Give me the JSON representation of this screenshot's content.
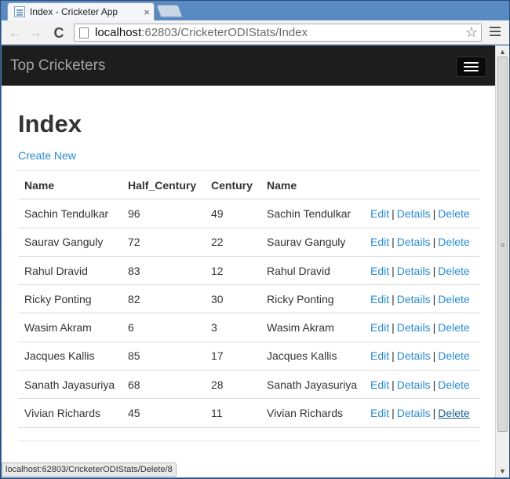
{
  "browser": {
    "tab_title": "Index - Cricketer App",
    "tab_close": "×",
    "url_host": "localhost",
    "url_path": ":62803/CricketerODIStats/Index",
    "status_url": "localhost:62803/CricketerODIStats/Delete/8"
  },
  "icons": {
    "back": "←",
    "forward": "→",
    "reload": "C",
    "star": "☆",
    "scroll_up": "▲",
    "scroll_down": "▼",
    "scroll_grip": "≡"
  },
  "navbar": {
    "brand": "Top Cricketers"
  },
  "page": {
    "title": "Index",
    "create_new": "Create New"
  },
  "table": {
    "headers": [
      "Name",
      "Half_Century",
      "Century",
      "Name",
      ""
    ],
    "rows": [
      {
        "name": "Sachin Tendulkar",
        "half_century": "96",
        "century": "49",
        "name2": "Sachin Tendulkar"
      },
      {
        "name": "Saurav Ganguly",
        "half_century": "72",
        "century": "22",
        "name2": "Saurav Ganguly"
      },
      {
        "name": "Rahul Dravid",
        "half_century": "83",
        "century": "12",
        "name2": "Rahul Dravid"
      },
      {
        "name": "Ricky Ponting",
        "half_century": "82",
        "century": "30",
        "name2": "Ricky Ponting"
      },
      {
        "name": "Wasim Akram",
        "half_century": "6",
        "century": "3",
        "name2": "Wasim Akram"
      },
      {
        "name": "Jacques Kallis",
        "half_century": "85",
        "century": "17",
        "name2": "Jacques Kallis"
      },
      {
        "name": "Sanath Jayasuriya",
        "half_century": "68",
        "century": "28",
        "name2": "Sanath Jayasuriya"
      },
      {
        "name": "Vivian Richards",
        "half_century": "45",
        "century": "11",
        "name2": "Vivian Richards"
      }
    ],
    "actions": {
      "edit": "Edit",
      "details": "Details",
      "delete": "Delete",
      "separator": "|"
    }
  },
  "colors": {
    "link": "#2a8cd0",
    "navbar_bg": "#1d1d1d",
    "brand_text": "#a3a3a3",
    "window_frame": "#4a7cb6"
  }
}
